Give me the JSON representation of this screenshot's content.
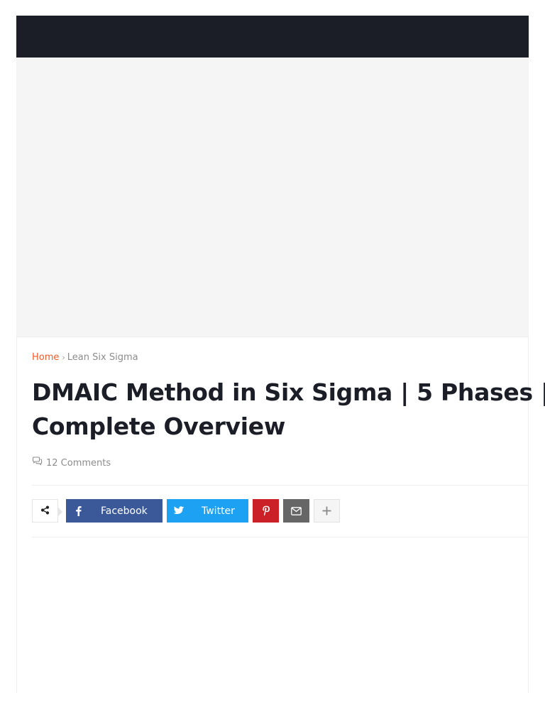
{
  "breadcrumb": {
    "home": "Home",
    "separator": "›",
    "category": "Lean Six Sigma"
  },
  "post": {
    "title_line1": "DMAIC Method in Six Sigma | 5 Phases |",
    "title_line2": "Complete Overview",
    "comments": "12 Comments"
  },
  "share": {
    "facebook_label": "Facebook",
    "twitter_label": "Twitter"
  },
  "icons": {
    "share": "share-icon",
    "comments": "comments-icon",
    "facebook": "facebook-icon",
    "twitter": "twitter-icon",
    "pinterest": "pinterest-icon",
    "email": "email-icon",
    "more": "plus-icon"
  },
  "colors": {
    "topbar": "#1b1e27",
    "accent": "#f05a28",
    "facebook": "#3b5998",
    "twitter": "#1da1f2",
    "pinterest": "#cb2027",
    "email": "#666666"
  }
}
